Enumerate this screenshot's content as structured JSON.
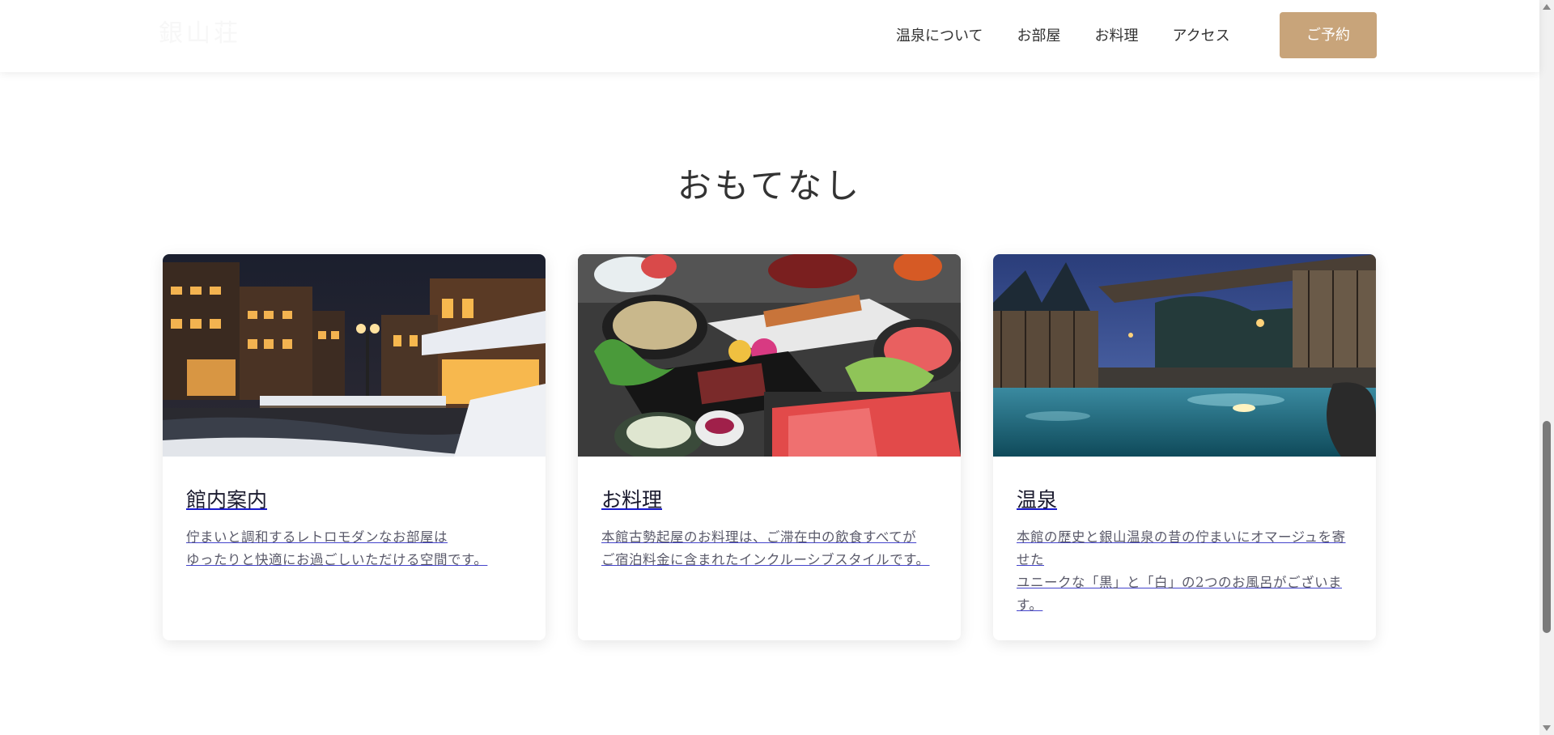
{
  "header": {
    "logo_text": "銀山荘",
    "nav": [
      "温泉について",
      "お部屋",
      "お料理",
      "アクセス"
    ],
    "reserve_label": "ご予約"
  },
  "section": {
    "title": "おもてなし"
  },
  "cards": [
    {
      "title": "館内案内",
      "text": "佇まいと調和するレトロモダンなお部屋は\nゆったりと快適にお過ごしいただける空間です。",
      "image": "night-onsen-town-photo"
    },
    {
      "title": "お料理",
      "text": "本館古勢起屋のお料理は、ご滞在中の飲食すべてが\nご宿泊料金に含まれたインクルーシブスタイルです。",
      "image": "kaiseki-meal-photo"
    },
    {
      "title": "温泉",
      "text": "本館の歴史と銀山温泉の昔の佇まいにオマージュを寄せた\nユニークな「黒」と「白」の2つのお風呂がございます。",
      "image": "open-air-bath-photo"
    }
  ],
  "colors": {
    "accent": "#c8a47a",
    "link": "#1a1acc"
  }
}
